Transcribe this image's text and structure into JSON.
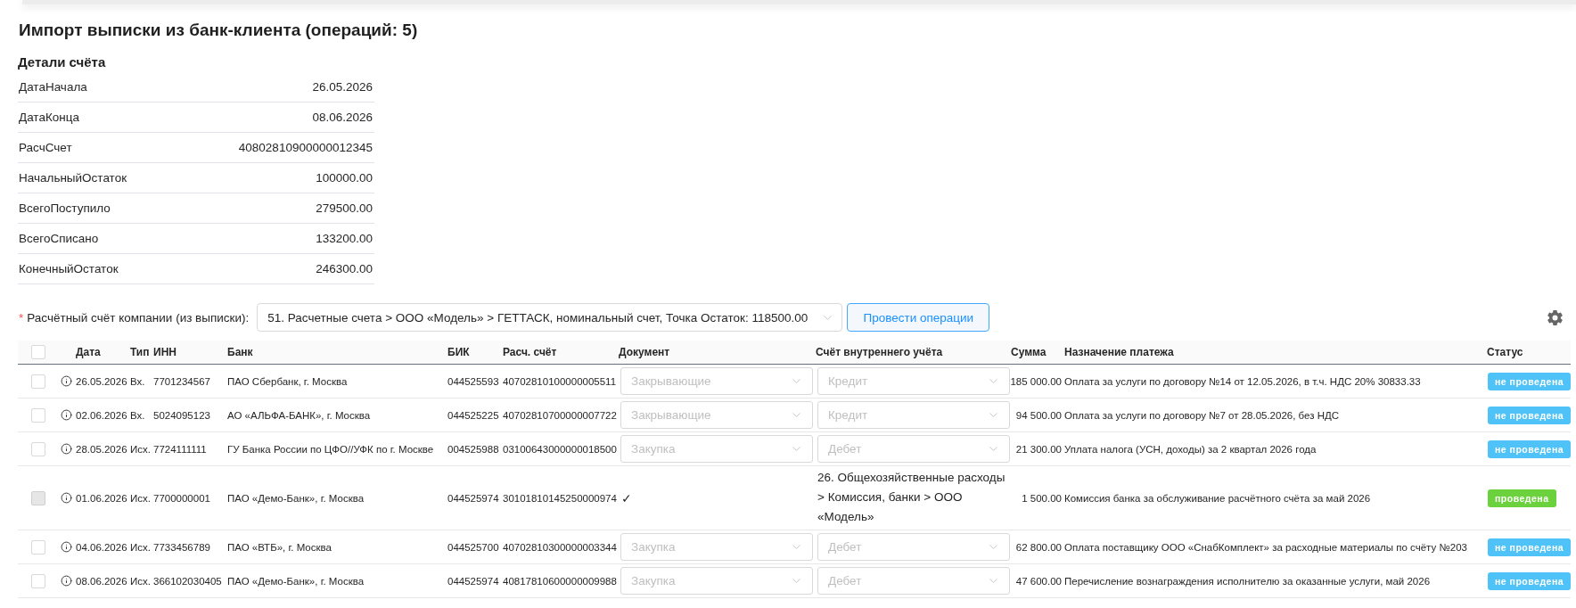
{
  "title": "Импорт выписки из банк-клиента (операций: 5)",
  "details": {
    "heading": "Детали счёта",
    "rows": [
      {
        "label": "ДатаНачала",
        "value": "26.05.2026"
      },
      {
        "label": "ДатаКонца",
        "value": "08.06.2026"
      },
      {
        "label": "РасчСчет",
        "value": "40802810900000012345"
      },
      {
        "label": "НачальныйОстаток",
        "value": "100000.00"
      },
      {
        "label": "ВсегоПоступило",
        "value": "279500.00"
      },
      {
        "label": "ВсегоСписано",
        "value": "133200.00"
      },
      {
        "label": "КонечныйОстаток",
        "value": "246300.00"
      }
    ]
  },
  "account_field": {
    "required_mark": "*",
    "label": "Расчётный счёт компании (из выписки):",
    "value": "51. Расчетные счета > ООО «Модель» > ГЕТТАСК, номинальный счет, Точка Остаток: 118500.00"
  },
  "submit_button": {
    "label": "Провести операции"
  },
  "table": {
    "select_all": {
      "checked": false
    },
    "columns": [
      "Дата",
      "Тип",
      "ИНН",
      "Банк",
      "БИК",
      "Расч. счёт",
      "Документ",
      "Счёт внутреннего учёта",
      "Сумма",
      "Назначение платежа",
      "Статус"
    ],
    "rows": [
      {
        "checked": false,
        "disabled": false,
        "date": "26.05.2026",
        "type": "Вх.",
        "inn": "7701234567",
        "bank": "ПАО Сбербанк, г. Москва",
        "bik": "044525593",
        "account": "40702810100000005511",
        "document": {
          "kind": "select",
          "placeholder": "Закрывающие"
        },
        "ledger_account": {
          "kind": "select",
          "placeholder": "Кредит"
        },
        "amount": "185 000.00",
        "purpose": "Оплата за услуги по договору №14 от 12.05.2026, в т.ч. НДС 20% 30833.33",
        "status": {
          "label": "не проведена",
          "posted": false
        }
      },
      {
        "checked": false,
        "disabled": false,
        "date": "02.06.2026",
        "type": "Вх.",
        "inn": "5024095123",
        "bank": "АО «АЛЬФА-БАНК», г. Москва",
        "bik": "044525225",
        "account": "40702810700000007722",
        "document": {
          "kind": "select",
          "placeholder": "Закрывающие"
        },
        "ledger_account": {
          "kind": "select",
          "placeholder": "Кредит"
        },
        "amount": "94 500.00",
        "purpose": "Оплата за услуги по договору №7 от 28.05.2026, без НДС",
        "status": {
          "label": "не проведена",
          "posted": false
        }
      },
      {
        "checked": false,
        "disabled": false,
        "date": "28.05.2026",
        "type": "Исх.",
        "inn": "7724111111",
        "bank": "ГУ Банка России по ЦФО//УФК по г. Москве",
        "bik": "004525988",
        "account": "03100643000000018500",
        "document": {
          "kind": "select",
          "placeholder": "Закупка"
        },
        "ledger_account": {
          "kind": "select",
          "placeholder": "Дебет"
        },
        "amount": "21 300.00",
        "purpose": "Уплата налога (УСН, доходы) за 2 квартал 2026 года",
        "status": {
          "label": "не проведена",
          "posted": false
        }
      },
      {
        "checked": false,
        "disabled": true,
        "date": "01.06.2026",
        "type": "Исх.",
        "inn": "7700000001",
        "bank": "ПАО «Демо-Банк», г. Москва",
        "bik": "044525974",
        "account": "30101810145250000974",
        "document": {
          "kind": "text",
          "text": "✓"
        },
        "ledger_account": {
          "kind": "text",
          "text": "26. Общехозяйственные расходы > Комиссия, банки > ООО «Модель»"
        },
        "amount": "1 500.00",
        "purpose": "Комиссия банка за обслуживание расчётного счёта за май 2026",
        "status": {
          "label": "проведена",
          "posted": true
        }
      },
      {
        "checked": false,
        "disabled": false,
        "date": "04.06.2026",
        "type": "Исх.",
        "inn": "7733456789",
        "bank": "ПАО «ВТБ», г. Москва",
        "bik": "044525700",
        "account": "40702810300000003344",
        "document": {
          "kind": "select",
          "placeholder": "Закупка"
        },
        "ledger_account": {
          "kind": "select",
          "placeholder": "Дебет"
        },
        "amount": "62 800.00",
        "purpose": "Оплата поставщику ООО «СнабКомплект» за расходные материалы по счёту №203",
        "status": {
          "label": "не проведена",
          "posted": false
        }
      },
      {
        "checked": false,
        "disabled": false,
        "date": "08.06.2026",
        "type": "Исх.",
        "inn": "366102030405",
        "bank": "ПАО «Демо-Банк», г. Москва",
        "bik": "044525974",
        "account": "40817810600000009988",
        "document": {
          "kind": "select",
          "placeholder": "Закупка"
        },
        "ledger_account": {
          "kind": "select",
          "placeholder": "Дебет"
        },
        "amount": "47 600.00",
        "purpose": "Перечисление вознаграждения исполнителю за оказанные услуги, май 2026",
        "status": {
          "label": "не проведена",
          "posted": false
        }
      }
    ]
  }
}
